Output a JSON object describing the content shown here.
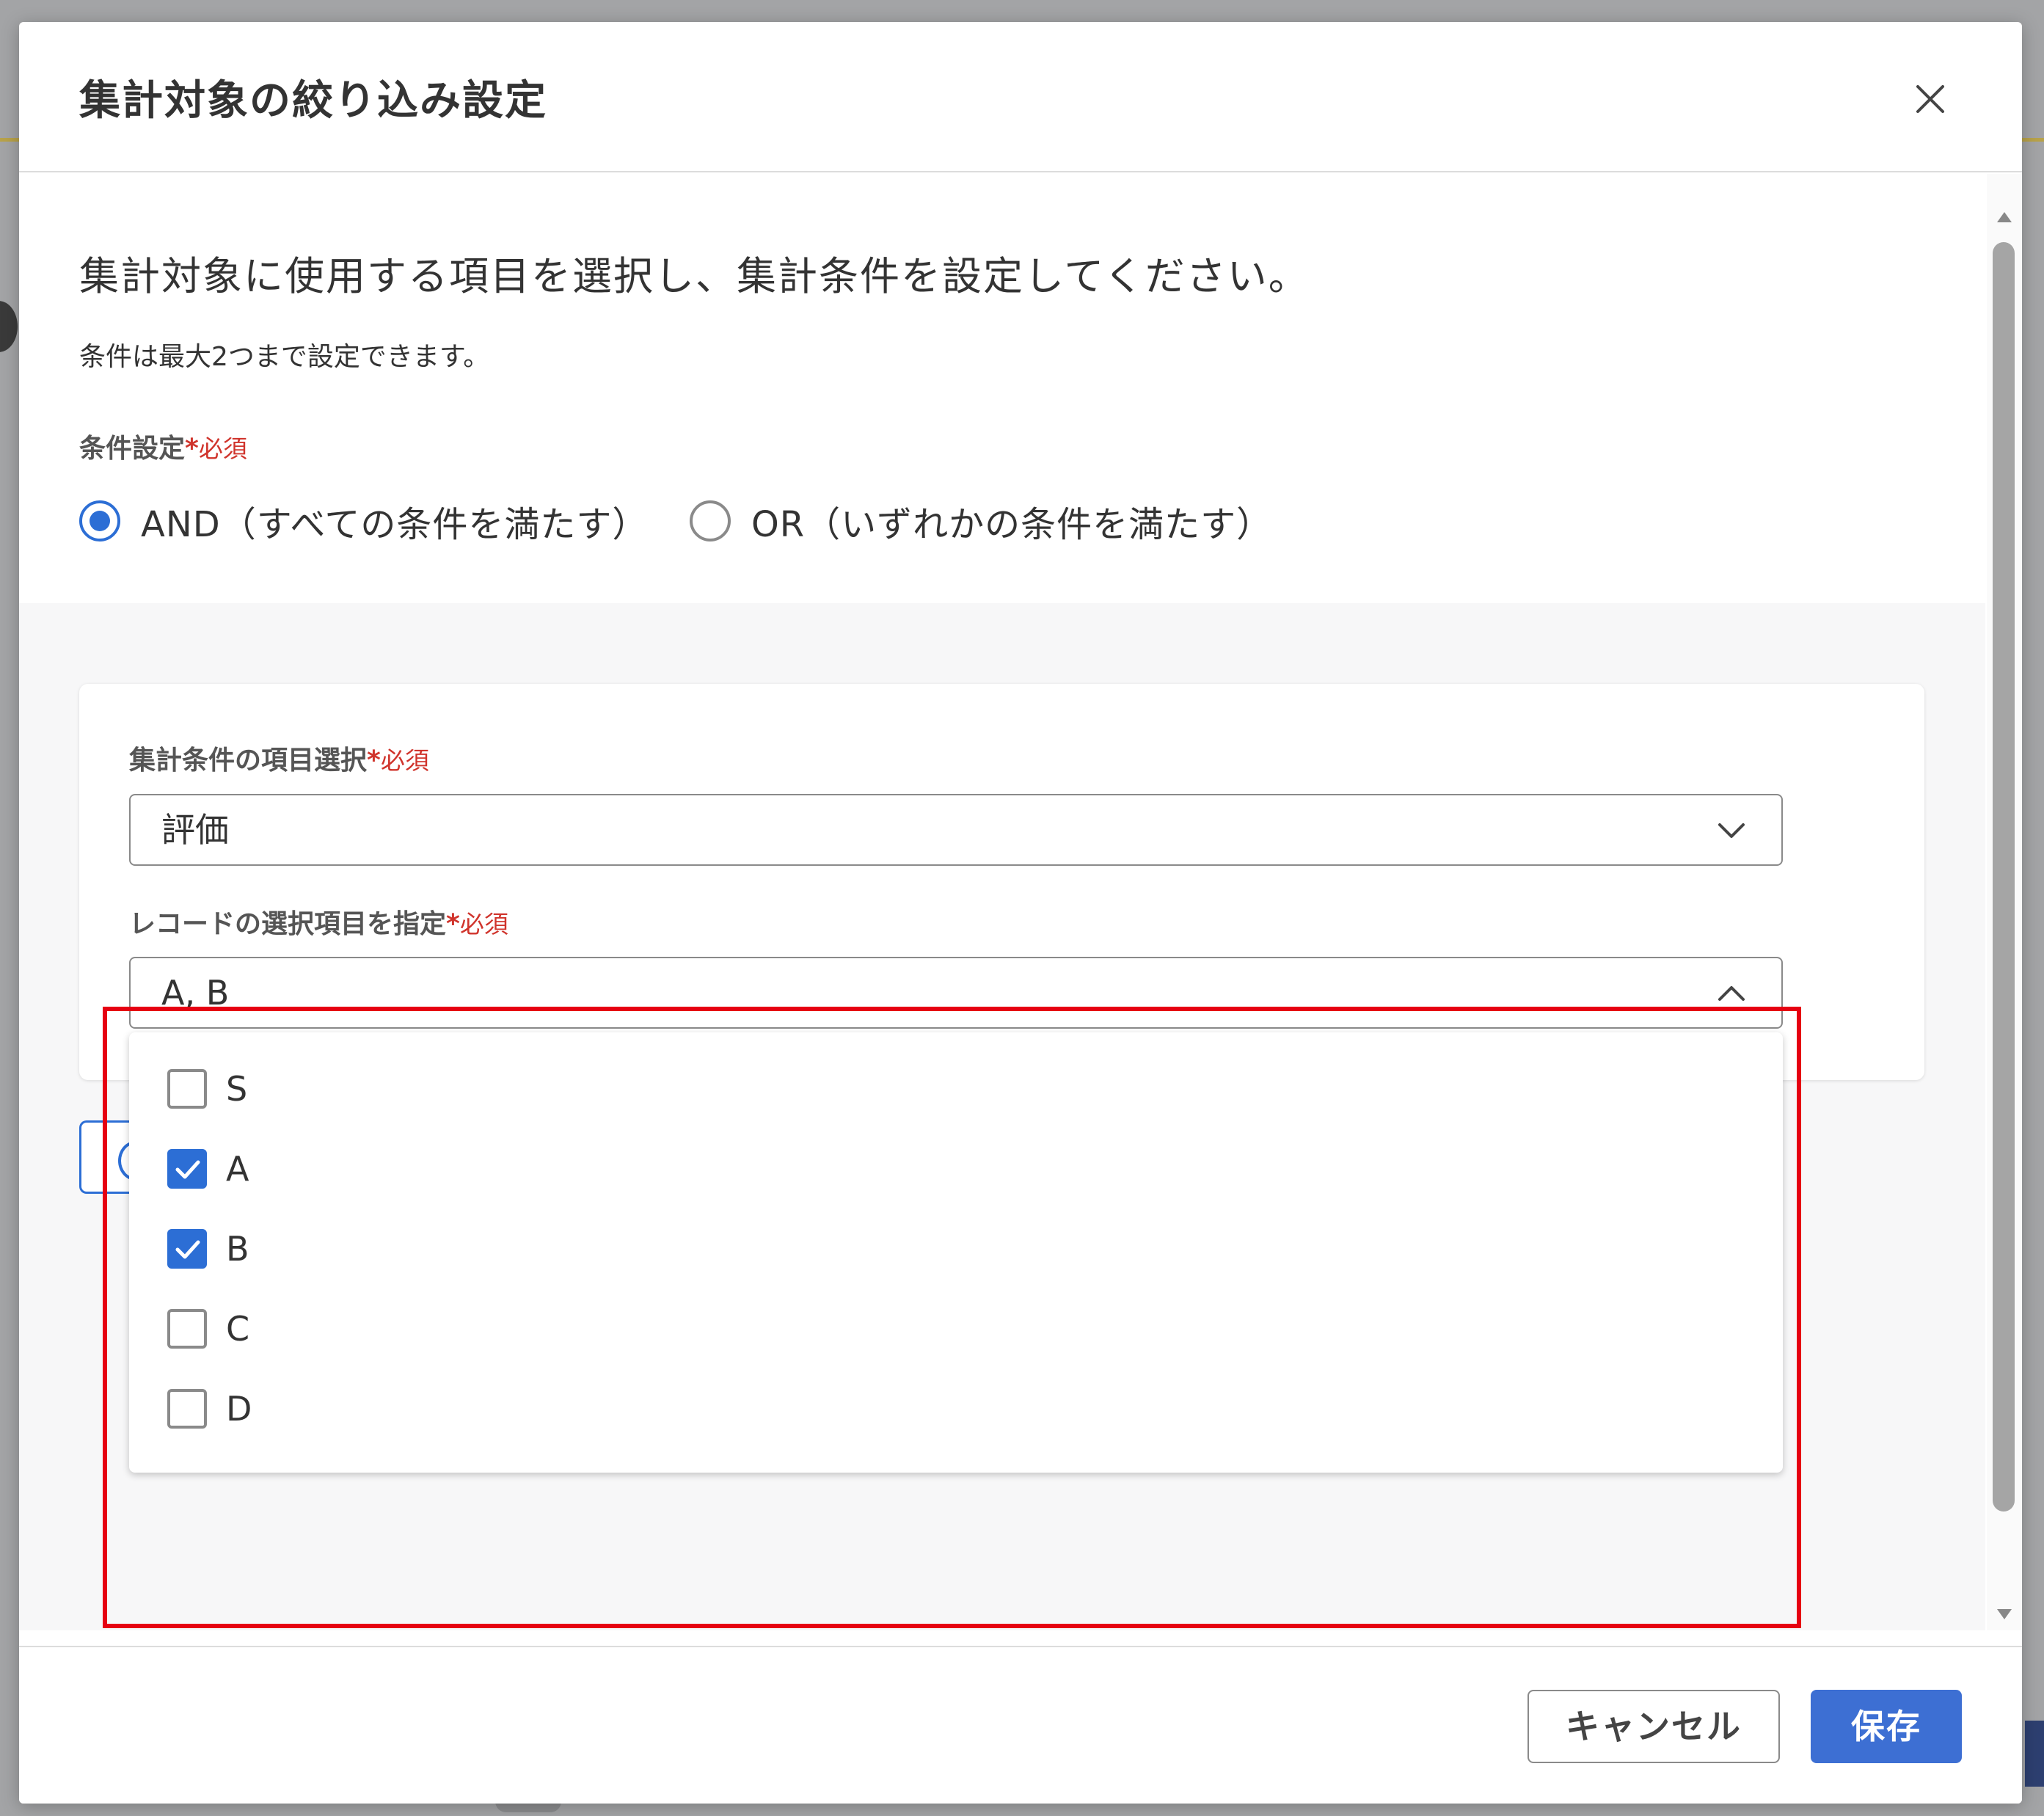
{
  "modal": {
    "title": "集計対象の絞り込み設定",
    "close_icon": "close-icon"
  },
  "intro": {
    "main": "集計対象に使用する項目を選択し、集計条件を設定してください。",
    "sub": "条件は最大2つまで設定できます。"
  },
  "condition": {
    "label": "条件設定",
    "required_mark": "*",
    "required_text": "必須",
    "options": [
      {
        "label": "AND（すべての条件を満たす）",
        "selected": true
      },
      {
        "label": "OR（いずれかの条件を満たす）",
        "selected": false
      }
    ]
  },
  "item_select": {
    "label": "集計条件の項目選択",
    "required_mark": "*",
    "required_text": "必須",
    "value": "評価"
  },
  "record_select": {
    "label": "レコードの選択項目を指定",
    "required_mark": "*",
    "required_text": "必須",
    "value": "A, B",
    "options": [
      {
        "label": "S",
        "checked": false
      },
      {
        "label": "A",
        "checked": true
      },
      {
        "label": "B",
        "checked": true
      },
      {
        "label": "C",
        "checked": false
      },
      {
        "label": "D",
        "checked": false
      }
    ]
  },
  "footer": {
    "cancel_label": "キャンセル",
    "save_label": "保存"
  },
  "colors": {
    "accent": "#2c6ed5",
    "required": "#d0342c",
    "highlight": "#e60012"
  }
}
